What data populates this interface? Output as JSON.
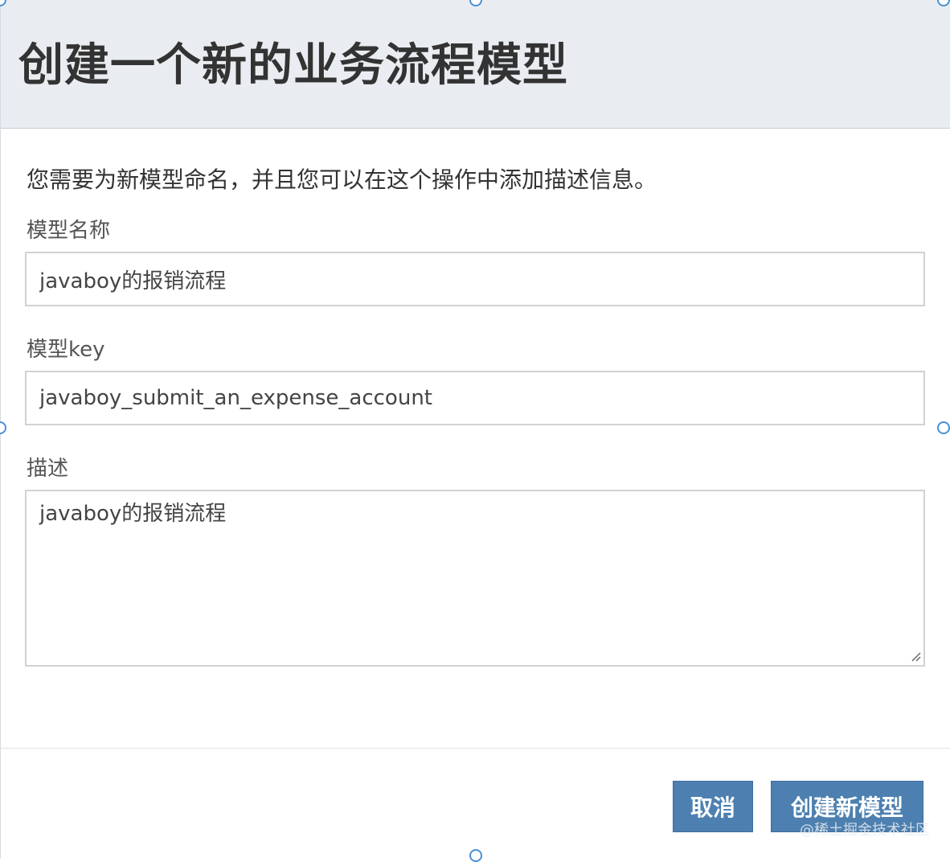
{
  "dialog": {
    "title": "创建一个新的业务流程模型",
    "intro": "您需要为新模型命名，并且您可以在这个操作中添加描述信息。",
    "name_field": {
      "label": "模型名称",
      "value": "javaboy的报销流程"
    },
    "key_field": {
      "label": "模型key",
      "value": "javaboy_submit_an_expense_account"
    },
    "description_field": {
      "label": "描述",
      "value": "javaboy的报销流程"
    },
    "buttons": {
      "cancel": "取消",
      "create": "创建新模型"
    }
  },
  "watermark": "@稀土掘金技术社区",
  "colors": {
    "button": "#4d80b0",
    "header_bg": "#e9edf1",
    "handle": "#4a8fd8"
  }
}
